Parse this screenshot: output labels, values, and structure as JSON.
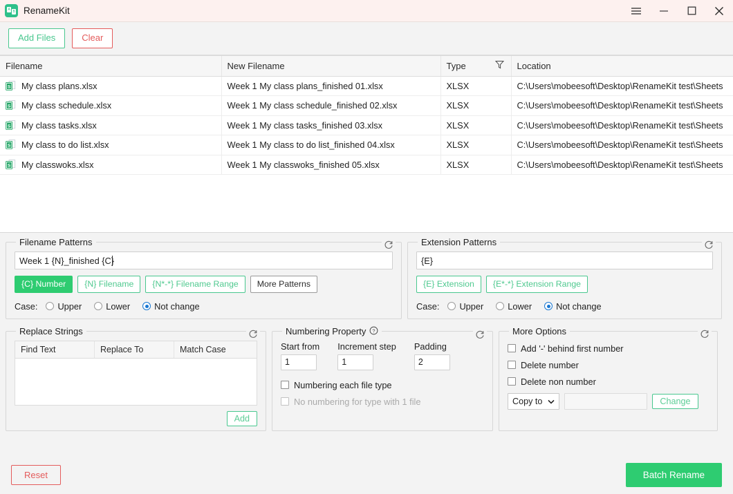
{
  "window": {
    "title": "RenameKit",
    "app_icon": "renamekit-logo-icon",
    "controls": {
      "menu": "menu-icon",
      "minimize": "minimize-icon",
      "maximize": "maximize-icon",
      "close": "close-icon"
    }
  },
  "toolbar": {
    "add_files_label": "Add Files",
    "clear_label": "Clear"
  },
  "file_table": {
    "columns": [
      "Filename",
      "New Filename",
      "Type",
      "Location"
    ],
    "filter_icon": "filter-icon",
    "rows": [
      {
        "filename": "My class plans.xlsx",
        "new_filename": "Week 1 My class plans_finished 01.xlsx",
        "type": "XLSX",
        "location": "C:\\Users\\mobeesoft\\Desktop\\RenameKit test\\Sheets"
      },
      {
        "filename": "My class schedule.xlsx",
        "new_filename": "Week 1 My class schedule_finished 02.xlsx",
        "type": "XLSX",
        "location": "C:\\Users\\mobeesoft\\Desktop\\RenameKit test\\Sheets"
      },
      {
        "filename": "My class tasks.xlsx",
        "new_filename": "Week 1 My class tasks_finished 03.xlsx",
        "type": "XLSX",
        "location": "C:\\Users\\mobeesoft\\Desktop\\RenameKit test\\Sheets"
      },
      {
        "filename": "My class to do list.xlsx",
        "new_filename": "Week 1 My class to do list_finished 04.xlsx",
        "type": "XLSX",
        "location": "C:\\Users\\mobeesoft\\Desktop\\RenameKit test\\Sheets"
      },
      {
        "filename": "My classwoks.xlsx",
        "new_filename": "Week 1 My classwoks_finished 05.xlsx",
        "type": "XLSX",
        "location": "C:\\Users\\mobeesoft\\Desktop\\RenameKit test\\Sheets"
      }
    ]
  },
  "filename_patterns": {
    "legend": "Filename Patterns",
    "refresh_icon": "refresh-icon",
    "input_value": "Week 1 {N}_finished {C}",
    "tags": [
      {
        "label": "{C} Number",
        "state": "active"
      },
      {
        "label": "{N} Filename",
        "state": "normal"
      },
      {
        "label": "{N*-*} Filename Range",
        "state": "normal"
      },
      {
        "label": "More Patterns",
        "state": "neutral"
      }
    ],
    "case_label": "Case:",
    "case_options": [
      {
        "label": "Upper",
        "selected": false
      },
      {
        "label": "Lower",
        "selected": false
      },
      {
        "label": "Not change",
        "selected": true
      }
    ]
  },
  "extension_patterns": {
    "legend": "Extension Patterns",
    "refresh_icon": "refresh-icon",
    "input_value": "{E}",
    "tags": [
      {
        "label": "{E} Extension",
        "state": "normal"
      },
      {
        "label": "{E*-*} Extension Range",
        "state": "normal"
      }
    ],
    "case_label": "Case:",
    "case_options": [
      {
        "label": "Upper",
        "selected": false
      },
      {
        "label": "Lower",
        "selected": false
      },
      {
        "label": "Not change",
        "selected": true
      }
    ]
  },
  "replace_strings": {
    "legend": "Replace Strings",
    "refresh_icon": "refresh-icon",
    "columns": [
      "Find Text",
      "Replace To",
      "Match Case"
    ],
    "rows": [],
    "add_label": "Add"
  },
  "numbering_property": {
    "legend": "Numbering Property",
    "help_icon": "help-icon",
    "refresh_icon": "refresh-icon",
    "start_from_label": "Start from",
    "start_from_value": "1",
    "increment_step_label": "Increment step",
    "increment_step_value": "1",
    "padding_label": "Padding",
    "padding_value": "2",
    "checkboxes": [
      {
        "label": "Numbering each file type",
        "checked": false,
        "enabled": true
      },
      {
        "label": "No numbering for type with 1 file",
        "checked": false,
        "enabled": false
      }
    ]
  },
  "more_options": {
    "legend": "More Options",
    "refresh_icon": "refresh-icon",
    "checkboxes": [
      {
        "label": "Add '-' behind first number",
        "checked": false
      },
      {
        "label": "Delete number",
        "checked": false
      },
      {
        "label": "Delete non number",
        "checked": false
      }
    ],
    "copy_to_label": "Copy to",
    "copy_to_caret": "chevron-down-icon",
    "copy_to_value": "",
    "change_label": "Change"
  },
  "footer": {
    "reset_label": "Reset",
    "batch_rename_label": "Batch Rename"
  },
  "colors": {
    "accent_green": "#2ecc71",
    "outline_green": "#48c78e",
    "danger_red": "#e45b5b",
    "titlebar_bg": "#fdf1ef",
    "panel_bg": "#f3f3f3",
    "radio_blue": "#1877d2"
  }
}
